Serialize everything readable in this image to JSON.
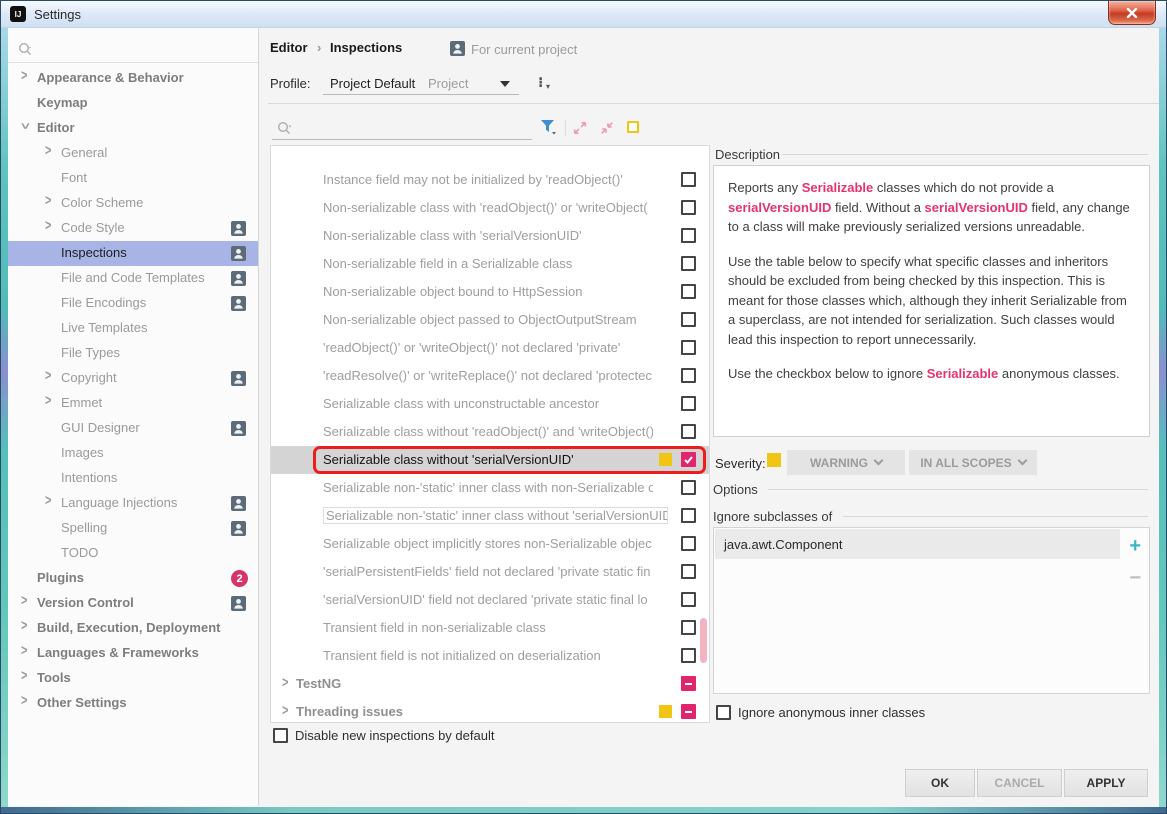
{
  "window": {
    "title": "Settings"
  },
  "sidebar": {
    "items": [
      {
        "label": "Appearance & Behavior",
        "level": 0,
        "bold": true,
        "chevron": "right"
      },
      {
        "label": "Keymap",
        "level": 0,
        "bold": true
      },
      {
        "label": "Editor",
        "level": 0,
        "bold": true,
        "chevron": "down"
      },
      {
        "label": "General",
        "level": 1,
        "chevron": "right"
      },
      {
        "label": "Font",
        "level": 1
      },
      {
        "label": "Color Scheme",
        "level": 1,
        "chevron": "right"
      },
      {
        "label": "Code Style",
        "level": 1,
        "chevron": "right",
        "badge": "person"
      },
      {
        "label": "Inspections",
        "level": 1,
        "selected": true,
        "badge": "person"
      },
      {
        "label": "File and Code Templates",
        "level": 1,
        "badge": "person"
      },
      {
        "label": "File Encodings",
        "level": 1,
        "badge": "person"
      },
      {
        "label": "Live Templates",
        "level": 1
      },
      {
        "label": "File Types",
        "level": 1
      },
      {
        "label": "Copyright",
        "level": 1,
        "chevron": "right",
        "badge": "person"
      },
      {
        "label": "Emmet",
        "level": 1,
        "chevron": "right"
      },
      {
        "label": "GUI Designer",
        "level": 1,
        "badge": "person"
      },
      {
        "label": "Images",
        "level": 1
      },
      {
        "label": "Intentions",
        "level": 1
      },
      {
        "label": "Language Injections",
        "level": 1,
        "chevron": "right",
        "badge": "person"
      },
      {
        "label": "Spelling",
        "level": 1,
        "badge": "person"
      },
      {
        "label": "TODO",
        "level": 1
      },
      {
        "label": "Plugins",
        "level": 0,
        "bold": true,
        "badge": "count",
        "badge_count": "2"
      },
      {
        "label": "Version Control",
        "level": 0,
        "bold": true,
        "chevron": "right",
        "badge": "person"
      },
      {
        "label": "Build, Execution, Deployment",
        "level": 0,
        "bold": true,
        "chevron": "right"
      },
      {
        "label": "Languages & Frameworks",
        "level": 0,
        "bold": true,
        "chevron": "right"
      },
      {
        "label": "Tools",
        "level": 0,
        "bold": true,
        "chevron": "right"
      },
      {
        "label": "Other Settings",
        "level": 0,
        "bold": true,
        "chevron": "right"
      }
    ]
  },
  "header": {
    "crumb1": "Editor",
    "crumb2": "Inspections",
    "scope": "For current project",
    "profile_label": "Profile:",
    "profile_value": "Project Default",
    "profile_type": "Project"
  },
  "inspections": {
    "rows": [
      {
        "label": "Instance field may not be initialized by 'readObject()'",
        "state": "unchecked"
      },
      {
        "label": "Non-serializable class with 'readObject()' or 'writeObject(",
        "state": "unchecked"
      },
      {
        "label": "Non-serializable class with 'serialVersionUID'",
        "state": "unchecked"
      },
      {
        "label": "Non-serializable field in a Serializable class",
        "state": "unchecked"
      },
      {
        "label": "Non-serializable object bound to HttpSession",
        "state": "unchecked"
      },
      {
        "label": "Non-serializable object passed to ObjectOutputStream",
        "state": "unchecked"
      },
      {
        "label": "'readObject()' or 'writeObject()' not declared 'private'",
        "state": "unchecked"
      },
      {
        "label": "'readResolve()' or 'writeReplace()' not declared 'protectec",
        "state": "unchecked"
      },
      {
        "label": "Serializable class with unconstructable ancestor",
        "state": "unchecked"
      },
      {
        "label": "Serializable class without 'readObject()' and 'writeObject()",
        "state": "unchecked"
      },
      {
        "label": "Serializable class without 'serialVersionUID'",
        "state": "checked",
        "yellow": true,
        "selected": true,
        "annotated": true
      },
      {
        "label": "Serializable non-'static' inner class with non-Serializable o",
        "state": "unchecked"
      },
      {
        "label": "Serializable non-'static' inner class without 'serialVersionUID'",
        "state": "unchecked",
        "boxed": true
      },
      {
        "label": "Serializable object implicitly stores non-Serializable objec",
        "state": "unchecked"
      },
      {
        "label": "'serialPersistentFields' field not declared 'private static fin",
        "state": "unchecked"
      },
      {
        "label": "'serialVersionUID' field not declared 'private static final lo",
        "state": "unchecked"
      },
      {
        "label": "Transient field in non-serializable class",
        "state": "unchecked"
      },
      {
        "label": "Transient field is not initialized on deserialization",
        "state": "unchecked"
      },
      {
        "label": "TestNG",
        "group": true,
        "state": "minus"
      },
      {
        "label": "Threading issues",
        "group": true,
        "state": "minus",
        "yellow": true
      }
    ],
    "disable_label": "Disable new inspections by default"
  },
  "details": {
    "description_title": "Description",
    "paragraphs": [
      [
        {
          "t": "Reports any "
        },
        {
          "t": "Serializable",
          "hl": true
        },
        {
          "t": " classes which do not provide a "
        },
        {
          "t": "serialVersionUID",
          "hl": true
        },
        {
          "t": " field. Without a "
        },
        {
          "t": "serialVersionUID",
          "hl": true
        },
        {
          "t": " field, any change to a class will make previously serialized versions unreadable."
        }
      ],
      [
        {
          "t": "Use the table below to specify what specific classes and inheritors should be excluded from being checked by this inspection. This is meant for those classes which, although they inherit Serializable from a superclass, are not intended for serialization. Such classes would lead this inspection to report unnecessarily."
        }
      ],
      [
        {
          "t": "Use the checkbox below to ignore "
        },
        {
          "t": "Serializable",
          "hl": true
        },
        {
          "t": " anonymous classes."
        }
      ]
    ],
    "severity_label": "Severity:",
    "severity_value": "WARNING",
    "scope_value": "IN ALL SCOPES",
    "options_title": "Options",
    "ignore_subclasses_title": "Ignore subclasses of",
    "subclasses": [
      "java.awt.Component"
    ],
    "ignore_anonymous_label": "Ignore anonymous inner classes"
  },
  "footer": {
    "ok": "OK",
    "cancel": "CANCEL",
    "apply": "APPLY"
  },
  "colors": {
    "accent_pink": "#e7326f",
    "checkbox_pink": "#e0256e",
    "warning_yellow": "#f0c514",
    "selection_blue": "#a9b4e6",
    "filter_blue": "#3f8ed0",
    "plus_teal": "#3ab6c2",
    "annotation_red": "#ee1d1d",
    "badge_red": "#d6356b"
  }
}
